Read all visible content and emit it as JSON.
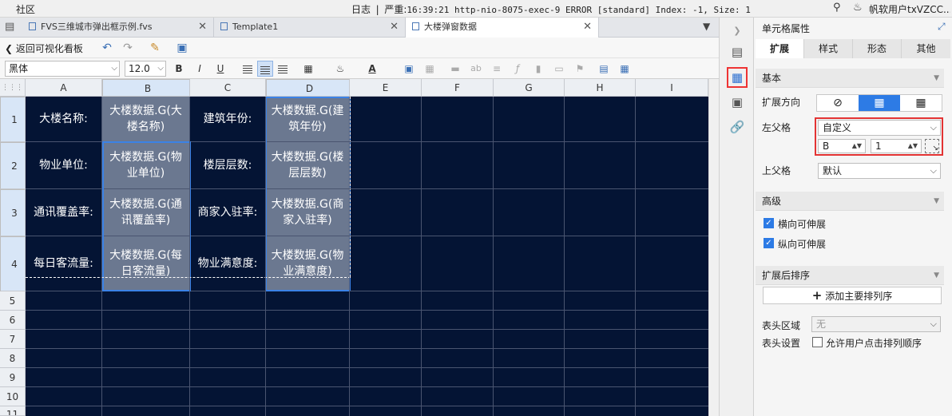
{
  "topbar": {
    "brand": "社区",
    "log_label": "日志",
    "log_sep": "|",
    "log_level": "严重:",
    "log_text": "16:39:21 http-nio-8075-exec-9 ERROR [standard] Index: -1, Size: 1",
    "search_icon": "search-icon",
    "bell_icon": "bell-icon",
    "user": "帆软用户txVZCC..."
  },
  "tabs": [
    {
      "label": "FVS三维城市弹出框示例.fvs",
      "icon": "fvs-file-icon"
    },
    {
      "label": "Template1",
      "icon": "template-file-icon"
    },
    {
      "label": "大楼弹窗数据",
      "icon": "template-file-icon"
    }
  ],
  "toolbar": {
    "back_label": "返回可视化看板",
    "font_family": "黑体",
    "font_size": "12.0",
    "bold": "B",
    "italic": "I",
    "underline": "U",
    "text_color_glyph": "A",
    "text_placeholder_ab": "ab"
  },
  "sheet": {
    "columns": [
      "A",
      "B",
      "C",
      "D",
      "E",
      "F",
      "G",
      "H",
      "I"
    ],
    "rows": [
      "1",
      "2",
      "3",
      "4",
      "5",
      "6",
      "7",
      "8",
      "9",
      "10",
      "11"
    ],
    "cells": [
      {
        "id": "A1",
        "text": "大楼名称:"
      },
      {
        "id": "B1",
        "text": "大楼数据.G(大楼名称)"
      },
      {
        "id": "C1",
        "text": "建筑年份:"
      },
      {
        "id": "D1",
        "text": "大楼数据.G(建筑年份)"
      },
      {
        "id": "A2",
        "text": "物业单位:"
      },
      {
        "id": "B2",
        "text": "大楼数据.G(物业单位)"
      },
      {
        "id": "C2",
        "text": "楼层层数:"
      },
      {
        "id": "D2",
        "text": "大楼数据.G(楼层层数)"
      },
      {
        "id": "A3",
        "text": "通讯覆盖率:"
      },
      {
        "id": "B3",
        "text": "大楼数据.G(通讯覆盖率)"
      },
      {
        "id": "C3",
        "text": "商家入驻率:"
      },
      {
        "id": "D3",
        "text": "大楼数据.G(商家入驻率)"
      },
      {
        "id": "A4",
        "text": "每日客流量:"
      },
      {
        "id": "B4",
        "text": "大楼数据.G(每日客流量)"
      },
      {
        "id": "C4",
        "text": "物业满意度:"
      },
      {
        "id": "D4",
        "text": "大楼数据.G(物业满意度)"
      }
    ]
  },
  "panel": {
    "title": "单元格属性",
    "tabs": [
      "扩展",
      "样式",
      "形态",
      "其他"
    ],
    "sections": {
      "basic": "基本",
      "advanced": "高级",
      "sort": "扩展后排序"
    },
    "expand_direction_label": "扩展方向",
    "left_parent_label": "左父格",
    "left_parent_value": "自定义",
    "left_parent_col": "B",
    "left_parent_row": "1",
    "upper_parent_label": "上父格",
    "upper_parent_value": "默认",
    "horiz_expand_label": "横向可伸展",
    "vert_expand_label": "纵向可伸展",
    "add_sort_label": "添加主要排列序",
    "header_area_label": "表头区域",
    "header_area_value": "无",
    "header_settings_label": "表头设置",
    "allow_sort_label": "允许用户点击排列顺序",
    "horiz_expand_checked": true,
    "vert_expand_checked": true,
    "allow_sort_checked": false
  },
  "colors": {
    "grid_bg": "#041434",
    "ds_cell_bg": "#6b7890",
    "highlight_red": "#e33333",
    "accent_blue": "#2d7be5"
  }
}
